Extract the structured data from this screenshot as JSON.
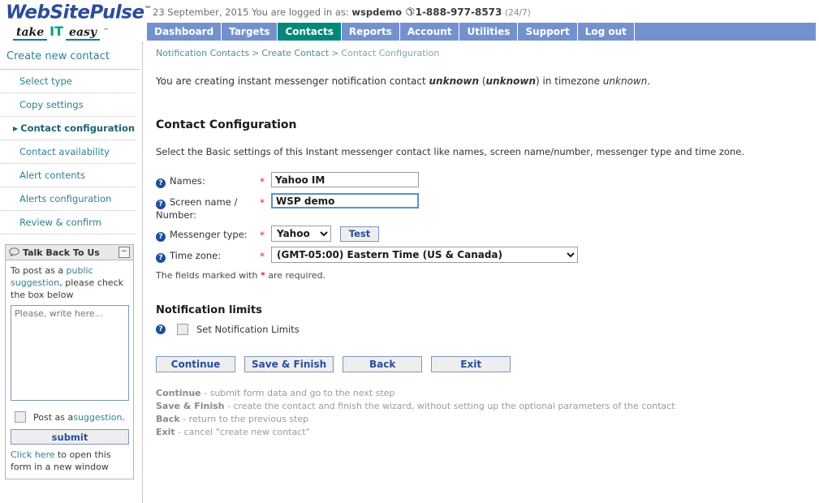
{
  "brand": {
    "name": "WebSitePulse",
    "tm": "™",
    "tagline_word1": "take",
    "tagline_it": "IT",
    "tagline_word2": "easy",
    "tagline_tm": "™",
    "logo_color": "#2b4c9b",
    "accent_color": "#00a37f"
  },
  "userbar": {
    "date": "23 September, 2015",
    "logged_label": "You are logged in as:",
    "username": "wspdemo",
    "phone_icon": "✆",
    "phone": "1-888-977-8573",
    "hours": "(24/7)"
  },
  "nav": {
    "active": "Contacts",
    "active_color": "#00897a",
    "bar_color": "#7392cd",
    "items": [
      {
        "label": "Dashboard"
      },
      {
        "label": "Targets"
      },
      {
        "label": "Contacts"
      },
      {
        "label": "Reports"
      },
      {
        "label": "Account"
      },
      {
        "label": "Utilities"
      },
      {
        "label": "Support"
      },
      {
        "label": "Log out"
      }
    ]
  },
  "sidebar": {
    "title": "Create new contact",
    "current_marker": "▶",
    "steps": [
      {
        "label": "Select type",
        "current": false
      },
      {
        "label": "Copy settings",
        "current": false
      },
      {
        "label": "Contact configuration",
        "current": true
      },
      {
        "label": "Contact availability",
        "current": false
      },
      {
        "label": "Alert contents",
        "current": false
      },
      {
        "label": "Alerts configuration",
        "current": false
      },
      {
        "label": "Review & confirm",
        "current": false
      }
    ],
    "talkback": {
      "title": "Talk Back To Us",
      "bubble_icon": "◯",
      "collapse_label": "−",
      "intro_a": "To post as a ",
      "intro_link1": "public suggestion",
      "intro_b": ", please check the box below",
      "textarea_placeholder": "Please, write here...",
      "textarea_value": "",
      "checkbox_text_a": "Post as a ",
      "checkbox_link": "suggestion",
      "checkbox_text_b": ".",
      "checkbox_checked": false,
      "submit_label": "submit",
      "foot_link": "Click here",
      "foot_text": " to open this form in a new window"
    }
  },
  "breadcrumb": {
    "items": [
      "Notification Contacts",
      "Create Contact",
      "Contact Configuration"
    ],
    "separator": ">"
  },
  "main": {
    "intro_a": "You are creating instant messenger notification contact ",
    "intro_bold1": "unknown",
    "intro_mid": " (",
    "intro_bold2": "unknown",
    "intro_mid2": ") in timezone ",
    "intro_italic": "unknown",
    "intro_end": ".",
    "section_title": "Contact Configuration",
    "section_desc": "Select the Basic settings of this Instant messenger contact like names, screen name/number, messenger type and time zone.",
    "help_icon": "?",
    "required_star": "*",
    "fields": {
      "names_label": "Names:",
      "names_value": "Yahoo IM",
      "screen_label": "Screen name / Number:",
      "screen_value": "WSP demo",
      "messenger_label": "Messenger type:",
      "messenger_value": "Yahoo",
      "messenger_options": [
        "Yahoo"
      ],
      "test_label": "Test",
      "timezone_label": "Time zone:",
      "timezone_value": "(GMT-05:00) Eastern Time (US & Canada)",
      "timezone_options": [
        "(GMT-05:00) Eastern Time (US & Canada)"
      ]
    },
    "required_note_a": "The fields marked with ",
    "required_note_star": "*",
    "required_note_b": " are required.",
    "limits_title": "Notification limits",
    "limits_checkbox_label": "Set Notification Limits",
    "limits_checked": false,
    "buttons": [
      {
        "label": "Continue"
      },
      {
        "label": "Save & Finish"
      },
      {
        "label": "Back"
      },
      {
        "label": "Exit"
      }
    ],
    "legend": [
      {
        "name": "Continue",
        "desc": " - submit form data and go to the next step"
      },
      {
        "name": "Save & Finish",
        "desc": " - create the contact and finish the wizard, without setting up the optional parameters of the contact"
      },
      {
        "name": "Back",
        "desc": " - return to the previous step"
      },
      {
        "name": "Exit",
        "desc": " - cancel \"create new contact\""
      }
    ]
  }
}
